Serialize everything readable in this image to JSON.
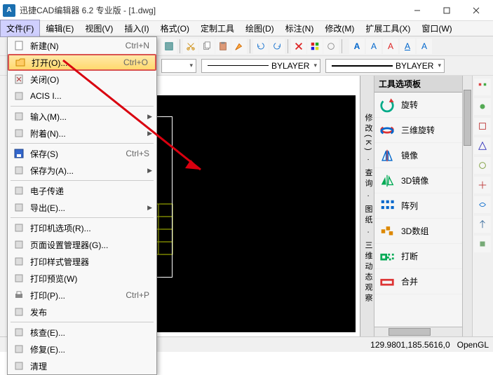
{
  "window": {
    "title": "迅捷CAD编辑器 6.2 专业版  -  [1.dwg]"
  },
  "menubar": [
    "文件(F)",
    "编辑(E)",
    "视图(V)",
    "插入(I)",
    "格式(O)",
    "定制工具",
    "绘图(D)",
    "标注(N)",
    "修改(M)",
    "扩展工具(X)",
    "窗口(W)"
  ],
  "file_menu": [
    {
      "label": "新建(N)",
      "shortcut": "Ctrl+N",
      "icon": "new"
    },
    {
      "label": "打开(O)...",
      "shortcut": "Ctrl+O",
      "icon": "open",
      "hl": true
    },
    {
      "label": "关闭(O)",
      "icon": "close"
    },
    {
      "label": "ACIS I...",
      "icon": "acis"
    },
    {
      "sep": true
    },
    {
      "label": "输入(M)...",
      "icon": "import",
      "sub": true
    },
    {
      "label": "附着(N)...",
      "icon": "attach",
      "sub": true
    },
    {
      "sep": true
    },
    {
      "label": "保存(S)",
      "shortcut": "Ctrl+S",
      "icon": "save"
    },
    {
      "label": "保存为(A)...",
      "icon": "saveas",
      "sub": true
    },
    {
      "sep": true
    },
    {
      "label": "电子传递",
      "icon": "etransmit"
    },
    {
      "label": "导出(E)...",
      "icon": "export",
      "sub": true
    },
    {
      "sep": true
    },
    {
      "label": "打印机选项(R)...",
      "icon": "printer"
    },
    {
      "label": "页面设置管理器(G)...",
      "icon": "pagesetup"
    },
    {
      "label": "打印样式管理器",
      "icon": "plotstyle"
    },
    {
      "label": "打印预览(W)",
      "icon": "preview"
    },
    {
      "label": "打印(P)...",
      "shortcut": "Ctrl+P",
      "icon": "print"
    },
    {
      "label": "发布",
      "icon": "publish"
    },
    {
      "sep": true
    },
    {
      "label": "核查(E)...",
      "icon": "audit"
    },
    {
      "label": "修复(E)...",
      "icon": "recover"
    },
    {
      "label": "清理",
      "icon": "purge"
    }
  ],
  "layer_row": {
    "bylayer1": "BYLAYER",
    "bylayer2": "BYLAYER"
  },
  "text_group": {
    "a1": "A",
    "a2": "A",
    "a3": "A",
    "a4": "A",
    "a5": "A"
  },
  "palette": {
    "title": "工具选项板",
    "vtab": "修改(K)  · 查询 · 图纸 · 三维动态观察",
    "items": [
      {
        "label": "旋转",
        "icon": "rotate"
      },
      {
        "label": "三维旋转",
        "icon": "rotate3d"
      },
      {
        "label": "镜像",
        "icon": "mirror"
      },
      {
        "label": "3D镜像",
        "icon": "mirror3d"
      },
      {
        "label": "阵列",
        "icon": "array"
      },
      {
        "label": "3D数组",
        "icon": "array3d"
      },
      {
        "label": "打断",
        "icon": "break"
      },
      {
        "label": "合并",
        "icon": "join"
      }
    ]
  },
  "status": {
    "coords": "129.9801,185.5616,0",
    "render": "OpenGL"
  }
}
